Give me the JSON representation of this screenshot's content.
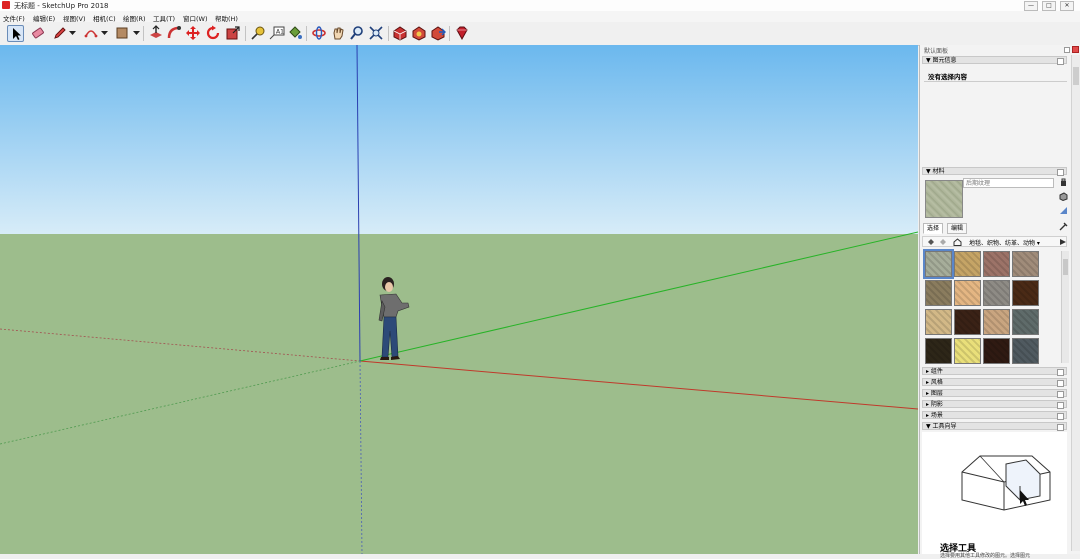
{
  "window": {
    "title": "无标题 - SketchUp Pro 2018",
    "controls": {
      "minimize": "—",
      "maximize": "□",
      "close": "✕"
    }
  },
  "menu": [
    "文件(F)",
    "编辑(E)",
    "视图(V)",
    "相机(C)",
    "绘图(R)",
    "工具(T)",
    "窗口(W)",
    "帮助(H)"
  ],
  "tray": {
    "title": "默认面板",
    "entity_info": {
      "header": "▼ 图元信息",
      "message": "没有选择内容"
    },
    "materials": {
      "header": "▼ 材料",
      "name_field": "后期纹理",
      "tabs": [
        "选择",
        "编辑"
      ],
      "library": "地毯、织物、纺革、动物 ▾",
      "swatches": [
        "#a6ad9a",
        "#c5a466",
        "#9c7368",
        "#a08c7a",
        "#8a7c5e",
        "#e4b683",
        "#8e8b85",
        "#4a2a16",
        "#d2b887",
        "#3a2216",
        "#c9a580",
        "#5f6b6a",
        "#2d2618",
        "#e9df7a",
        "#2f1a12",
        "#505a60"
      ]
    },
    "collapsed_panels": [
      "▸ 组件",
      "▸ 风格",
      "▸ 图层",
      "▸ 阴影",
      "▸ 场景"
    ],
    "instructor": {
      "header": "▼ 工具向导",
      "title": "选择工具",
      "subtitle": "选择要用其他工具修改的图元。选择图元"
    }
  },
  "colors": {
    "sky_top": "#6bb8ee",
    "sky_bottom": "#d7ecf8",
    "ground": "#9dbd8c",
    "axis_red": "#c0392b",
    "axis_green": "#27b327",
    "axis_blue": "#2b3fb0",
    "accent": "#5a86c9"
  },
  "icons": [
    "select-icon",
    "eraser-icon",
    "pencil-icon",
    "arc-icon",
    "rectangle-icon",
    "push-pull-icon",
    "follow-me-icon",
    "move-icon",
    "rotate-icon",
    "scale-icon",
    "tape-measure-icon",
    "text-icon",
    "paint-bucket-icon",
    "orbit-icon",
    "pan-icon",
    "zoom-icon",
    "zoom-extents-icon",
    "warehouse-icon",
    "extension-icon",
    "share-icon",
    "ruby-icon"
  ]
}
